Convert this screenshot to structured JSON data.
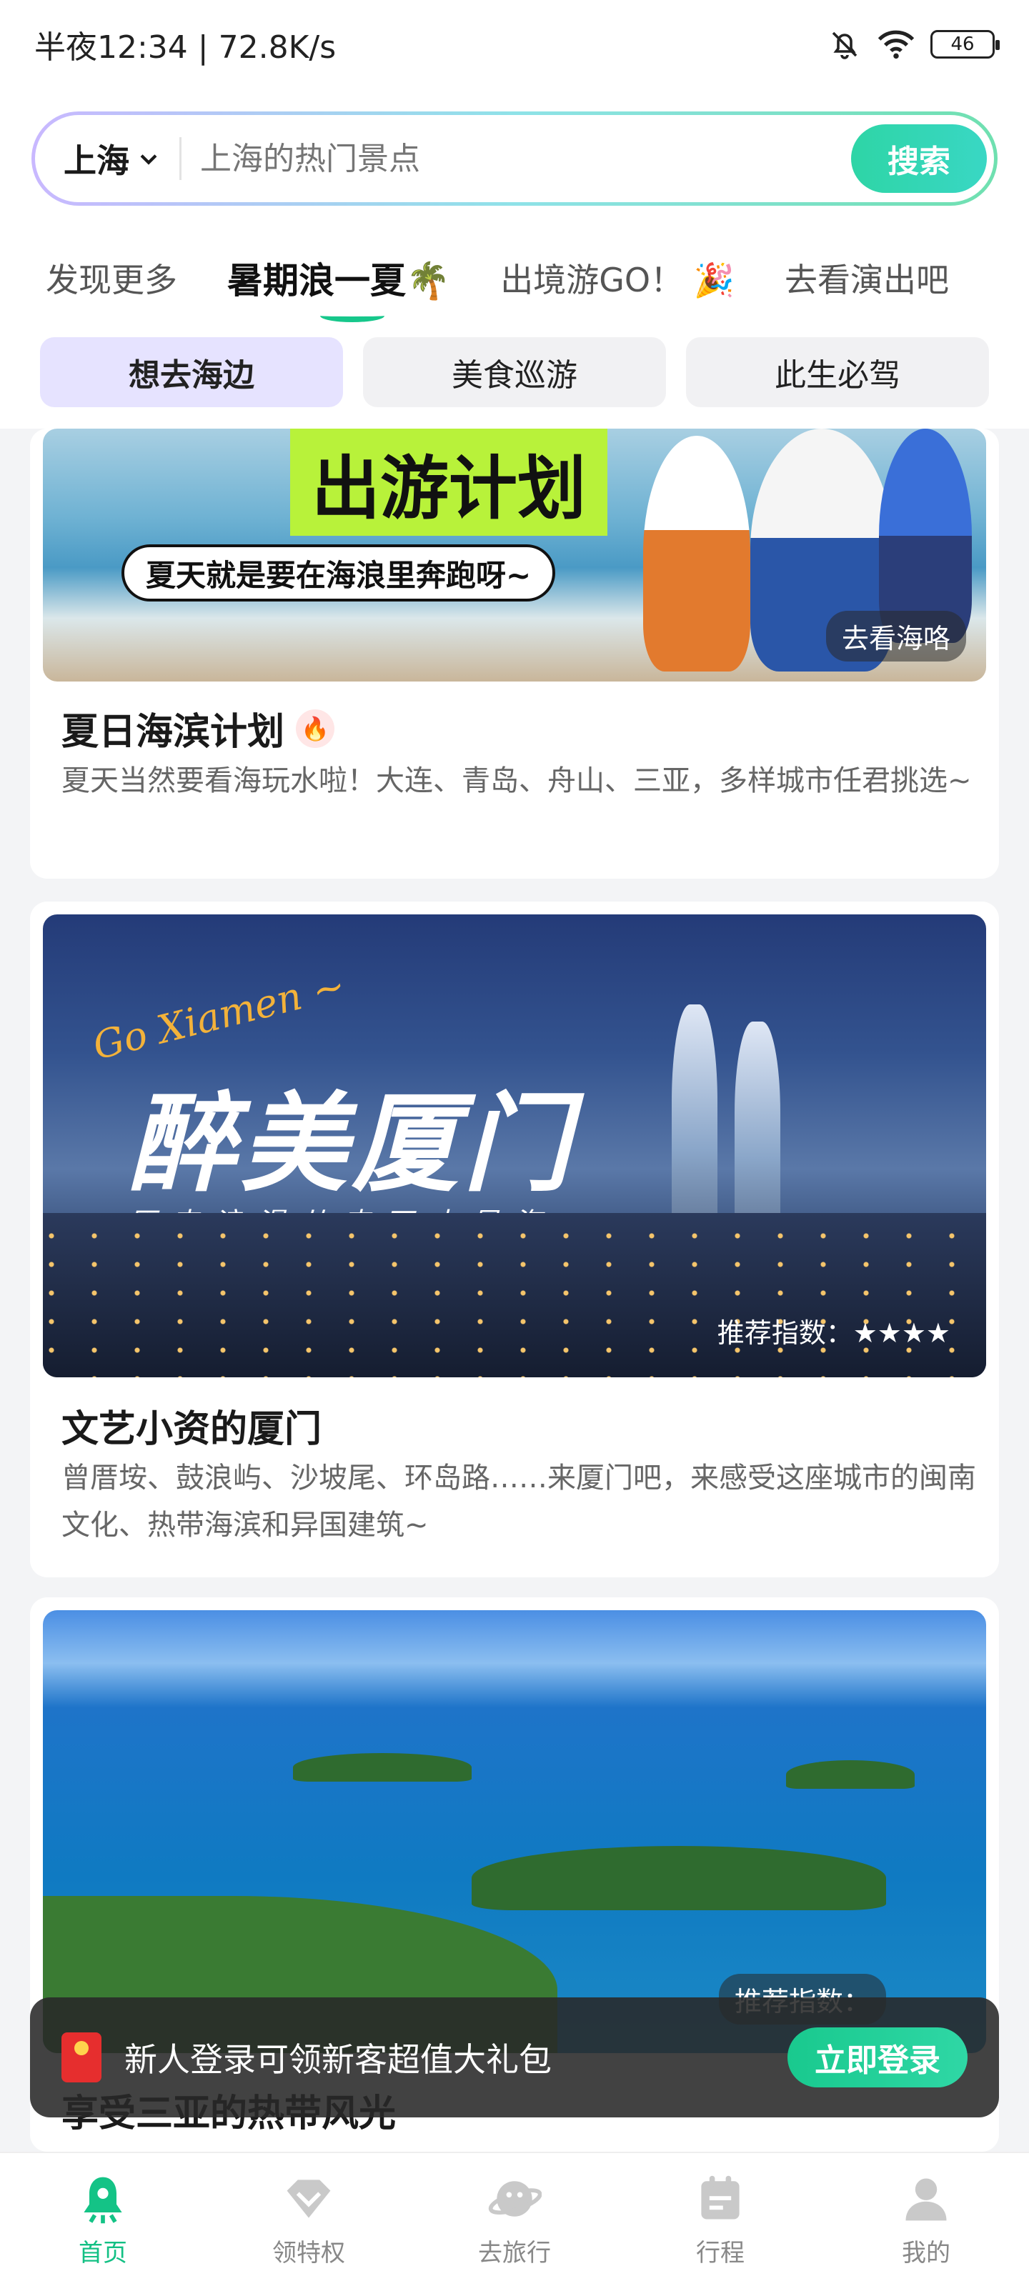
{
  "status_bar": {
    "time_speed": "半夜12:34 | 72.8K/s",
    "battery": "46",
    "icons": [
      "mute-bell-icon",
      "wifi-icon",
      "battery-icon"
    ]
  },
  "search": {
    "city": "上海",
    "placeholder": "上海的热门景点",
    "button": "搜索"
  },
  "tabs": [
    {
      "label": "发现更多",
      "emoji": ""
    },
    {
      "label": "暑期浪一夏",
      "emoji": "🌴"
    },
    {
      "label": "出境游GO！",
      "emoji": "🎉"
    },
    {
      "label": "去看演出吧",
      "emoji": ""
    }
  ],
  "chips": [
    "想去海边",
    "美食巡游",
    "此生必驾"
  ],
  "cards": [
    {
      "banner": "出游计划",
      "banner_sub": "夏天就是要在海浪里奔跑呀~",
      "tag": "去看海咯",
      "title": "夏日海滨计划",
      "desc": "夏天当然要看海玩水啦！大连、青岛、舟山、三亚，多样城市任君挑选~"
    },
    {
      "go_text": "Go Xiamen ~",
      "big_title": "醉美厦门",
      "sub_title": "原来浪漫从来不止是海",
      "tag": "推荐指数：★★★★",
      "title": "文艺小资的厦门",
      "desc": "曾厝垵、鼓浪屿、沙坡尾、环岛路……来厦门吧，来感受这座城市的闽南文化、热带海滨和异国建筑~"
    },
    {
      "tag": "推荐指数：",
      "title": "享受三亚的热带风光"
    }
  ],
  "toast": {
    "text": "新人登录可领新客超值大礼包",
    "button": "立即登录"
  },
  "bottom_nav": [
    {
      "label": "首页",
      "icon": "home-icon",
      "active": true
    },
    {
      "label": "领特权",
      "icon": "diamond-icon",
      "active": false
    },
    {
      "label": "去旅行",
      "icon": "planet-icon",
      "active": false
    },
    {
      "label": "行程",
      "icon": "itinerary-icon",
      "active": false
    },
    {
      "label": "我的",
      "icon": "profile-icon",
      "active": false
    }
  ],
  "colors": {
    "accent": "#16c78b",
    "chip_active_bg": "#e6e3ff"
  }
}
